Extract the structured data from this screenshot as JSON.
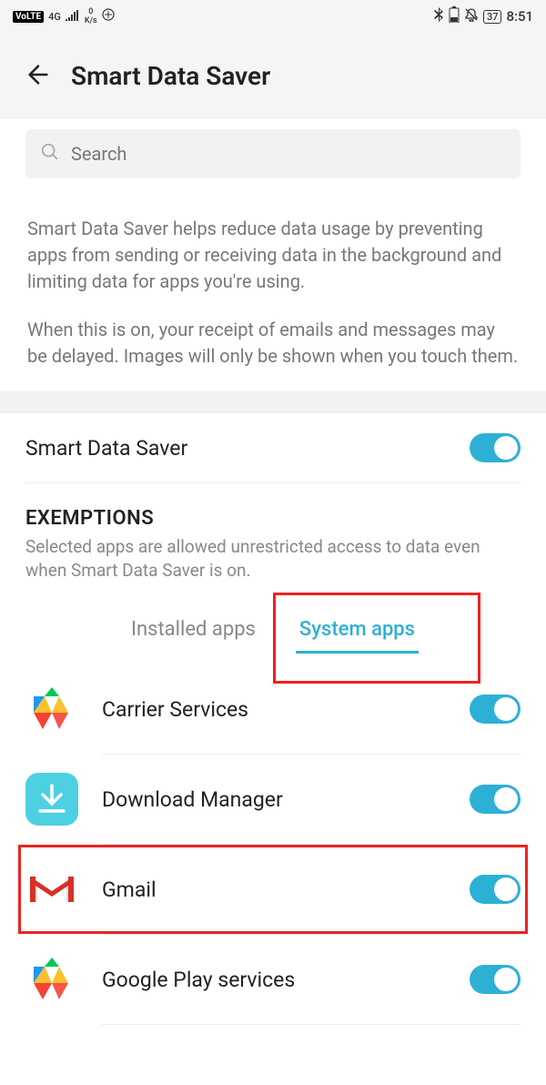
{
  "status_bar": {
    "volte": "VoLTE",
    "net": "4G",
    "speed_val": "0",
    "speed_unit": "K/s",
    "battery": "37",
    "time": "8:51"
  },
  "header": {
    "title": "Smart Data Saver"
  },
  "search": {
    "placeholder": "Search"
  },
  "description": {
    "p1": "Smart Data Saver helps reduce data usage by preventing apps from sending or receiving data in the background and limiting data for apps you're using.",
    "p2": "When this is on, your receipt of emails and messages may be delayed. Images will only be shown when you touch them."
  },
  "main_toggle": {
    "label": "Smart Data Saver",
    "on": true
  },
  "exemptions": {
    "title": "EXEMPTIONS",
    "subtitle": "Selected apps are allowed unrestricted access to data even when Smart Data Saver is on."
  },
  "tabs": {
    "installed": "Installed apps",
    "system": "System apps"
  },
  "apps": [
    {
      "name": "Carrier Services"
    },
    {
      "name": "Download Manager"
    },
    {
      "name": "Gmail"
    },
    {
      "name": "Google Play services"
    }
  ]
}
